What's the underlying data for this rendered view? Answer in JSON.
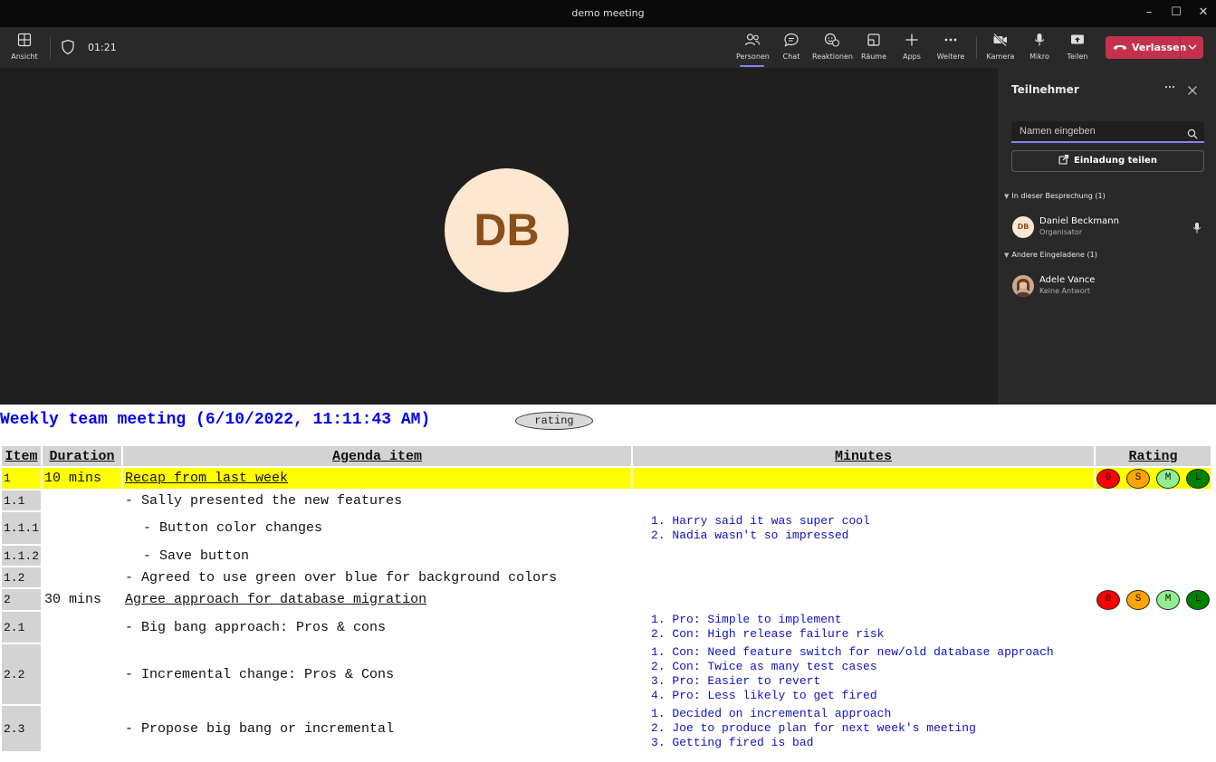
{
  "window": {
    "title": "demo meeting",
    "controls": {
      "minimize": "–",
      "maximize": "☐",
      "close": "✕"
    }
  },
  "toolbar": {
    "view_label": "Ansicht",
    "timer": "01:21",
    "items": {
      "people": "Personen",
      "chat": "Chat",
      "reactions": "Reaktionen",
      "rooms": "Räume",
      "apps": "Apps",
      "more": "Weitere",
      "camera": "Kamera",
      "mic": "Mikro",
      "share": "Teilen"
    },
    "leave_label": "Verlassen",
    "colors": {
      "leave": "#c4314b",
      "accent": "#7f85f5"
    }
  },
  "stage": {
    "avatar_initials": "DB"
  },
  "participants_panel": {
    "title": "Teilnehmer",
    "search_placeholder": "Namen eingeben",
    "invite_label": "Einladung teilen",
    "section_in_meeting": "In dieser Besprechung (1)",
    "section_others": "Andere Eingeladene (1)",
    "people": [
      {
        "initials": "DB",
        "name": "Daniel Beckmann",
        "role": "Organisator"
      },
      {
        "name": "Adele Vance",
        "role": "Keine Antwort"
      }
    ]
  },
  "document": {
    "title": "Weekly team meeting (6/10/2022, 11:11:43 AM)",
    "rating_pill": "rating",
    "headers": {
      "item": "Item",
      "duration": "Duration",
      "agenda": "Agenda item",
      "minutes": "Minutes",
      "rating": "Rating"
    },
    "rating_buttons": [
      "0",
      "S",
      "M",
      "L"
    ],
    "rating_colors": [
      "#ff0000",
      "#ffa500",
      "#90ee90",
      "#008000"
    ],
    "rows": [
      {
        "item": "1",
        "duration": "10 mins",
        "agenda": "Recap from last week",
        "minutes": []
      },
      {
        "item": "1.1",
        "duration": "",
        "agenda": "- Sally presented the new features",
        "minutes": []
      },
      {
        "item": "1.1.1",
        "duration": "",
        "agenda": "  - Button color changes",
        "minutes": [
          "1. Harry said it was super cool",
          "2. Nadia wasn't so impressed"
        ]
      },
      {
        "item": "1.1.2",
        "duration": "",
        "agenda": "  - Save button",
        "minutes": []
      },
      {
        "item": "1.2",
        "duration": "",
        "agenda": "- Agreed to use green over blue for background colors",
        "minutes": []
      },
      {
        "item": "2",
        "duration": "30 mins",
        "agenda": "Agree approach for database migration",
        "minutes": []
      },
      {
        "item": "2.1",
        "duration": "",
        "agenda": "- Big bang approach: Pros & cons",
        "minutes": [
          "1. Pro: Simple to implement",
          "2. Con: High release failure risk"
        ]
      },
      {
        "item": "2.2",
        "duration": "",
        "agenda": "- Incremental change: Pros & Cons",
        "minutes": [
          "1. Con: Need feature switch for new/old database approach",
          "2. Con: Twice as many test cases",
          "3. Pro: Easier to revert",
          "4. Pro: Less likely to get fired"
        ]
      },
      {
        "item": "2.3",
        "duration": "",
        "agenda": "- Propose big bang or incremental",
        "minutes": [
          "1. Decided on incremental approach",
          "2. Joe to produce plan for next week's meeting",
          "3. Getting fired is bad"
        ]
      }
    ]
  }
}
